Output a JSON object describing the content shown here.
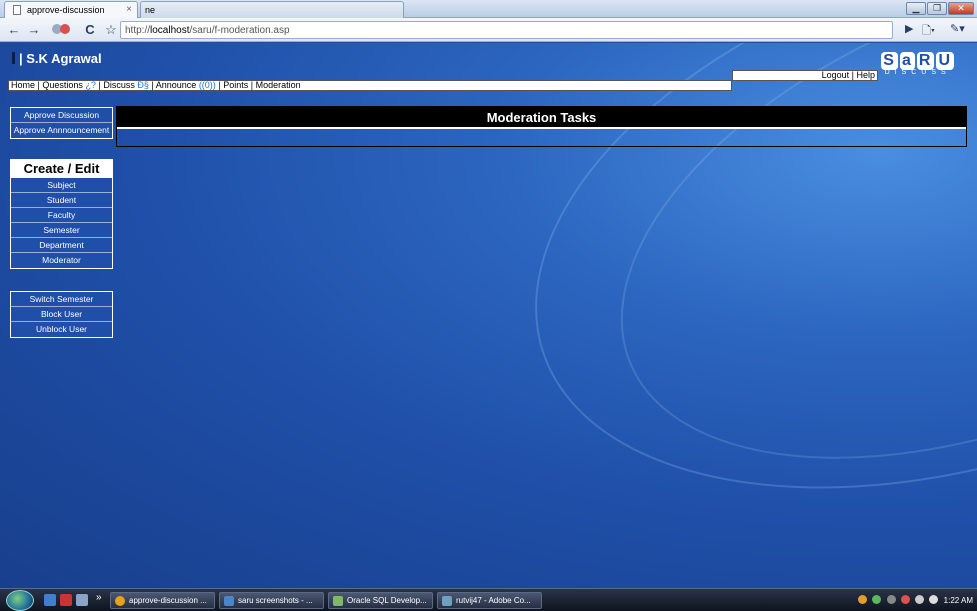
{
  "browser": {
    "tabs": [
      {
        "label": "approve-discussion",
        "close": "×"
      },
      {
        "label": "ne"
      }
    ],
    "window_buttons": {
      "minimize": "▁",
      "maximize": "❐",
      "close": "✕"
    },
    "nav": {
      "back": "←",
      "forward": "→",
      "reload": "C",
      "star": "☆"
    },
    "url_prefix": "http://",
    "url_host": "localhost",
    "url_path": "/saru/f-moderation.asp",
    "toolbar_icons": {
      "play": "▶",
      "page": "🗋▾",
      "wrench": "✎▾"
    }
  },
  "header": {
    "user_prefix": "|",
    "user_name": "S.K Agrawal",
    "logo_letters": [
      "S",
      "a",
      "R",
      "U"
    ],
    "logo_sub": "DISCUSS",
    "logout": "Logout",
    "sep": " | ",
    "help": "Help"
  },
  "navbar": {
    "items": [
      {
        "label": "Home",
        "suffix": ""
      },
      {
        "label": "Questions",
        "suffix": "¿?"
      },
      {
        "label": "Discuss",
        "suffix": "Ð§"
      },
      {
        "label": "Announce",
        "suffix": "((0))"
      },
      {
        "label": "Points",
        "suffix": ""
      },
      {
        "label": "Moderation",
        "suffix": ""
      }
    ]
  },
  "sidebar": {
    "approve": [
      "Approve Discussion",
      "Approve Annnouncement"
    ],
    "create_header": "Create / Edit",
    "create_items": [
      "Subject",
      "Student",
      "Faculty",
      "Semester",
      "Department",
      "Moderator"
    ],
    "admin_items": [
      "Switch Semester",
      "Block User",
      "Unblock User"
    ]
  },
  "main": {
    "panel_title": "Moderation Tasks"
  },
  "taskbar": {
    "quicklaunch_more": "»",
    "tasks": [
      {
        "label": "approve-discussion ...",
        "color": "#e8a21a"
      },
      {
        "label": "saru screenshots - ...",
        "color": "#4a86c8"
      },
      {
        "label": "Oracle SQL Develop...",
        "color": "#7fb86a"
      },
      {
        "label": "rutvij47 - Adobe Co...",
        "color": "#6fa0c0"
      }
    ],
    "clock": "1:22 AM"
  },
  "colors": {
    "page_bg": "#1f4fa8",
    "link_symbol": "#1a73e8",
    "panel_header": "#000000"
  }
}
